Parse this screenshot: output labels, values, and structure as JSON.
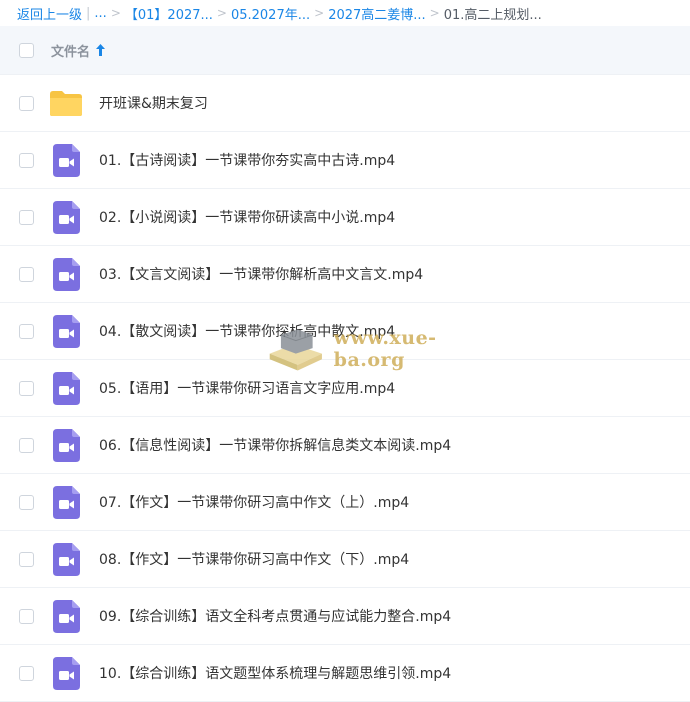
{
  "breadcrumb": {
    "back_label": "返回上一级",
    "ellipsis": "...",
    "items": [
      "【01】2027...",
      "05.2027年...",
      "2027高二姜博...",
      "01.高二上规划..."
    ]
  },
  "header": {
    "column_label": "文件名"
  },
  "colors": {
    "accent": "#1a86e6",
    "folder": "#f7c443",
    "video": "#7b6fe0"
  },
  "files": [
    {
      "name": "开班课&期末复习",
      "icon": "folder-icon"
    },
    {
      "name": "01.【古诗阅读】一节课带你夯实高中古诗.mp4",
      "icon": "video-file-icon"
    },
    {
      "name": "02.【小说阅读】一节课带你研读高中小说.mp4",
      "icon": "video-file-icon"
    },
    {
      "name": "03.【文言文阅读】一节课带你解析高中文言文.mp4",
      "icon": "video-file-icon"
    },
    {
      "name": "04.【散文阅读】一节课带你探析高中散文.mp4",
      "icon": "video-file-icon"
    },
    {
      "name": "05.【语用】一节课带你研习语言文字应用.mp4",
      "icon": "video-file-icon"
    },
    {
      "name": "06.【信息性阅读】一节课带你拆解信息类文本阅读.mp4",
      "icon": "video-file-icon"
    },
    {
      "name": "07.【作文】一节课带你研习高中作文（上）.mp4",
      "icon": "video-file-icon"
    },
    {
      "name": "08.【作文】一节课带你研习高中作文（下）.mp4",
      "icon": "video-file-icon"
    },
    {
      "name": "09.【综合训练】语文全科考点贯通与应试能力整合.mp4",
      "icon": "video-file-icon"
    },
    {
      "name": "10.【综合训练】语文题型体系梳理与解题思维引领.mp4",
      "icon": "video-file-icon"
    }
  ],
  "watermark": {
    "text": "www.xue-ba.org"
  }
}
